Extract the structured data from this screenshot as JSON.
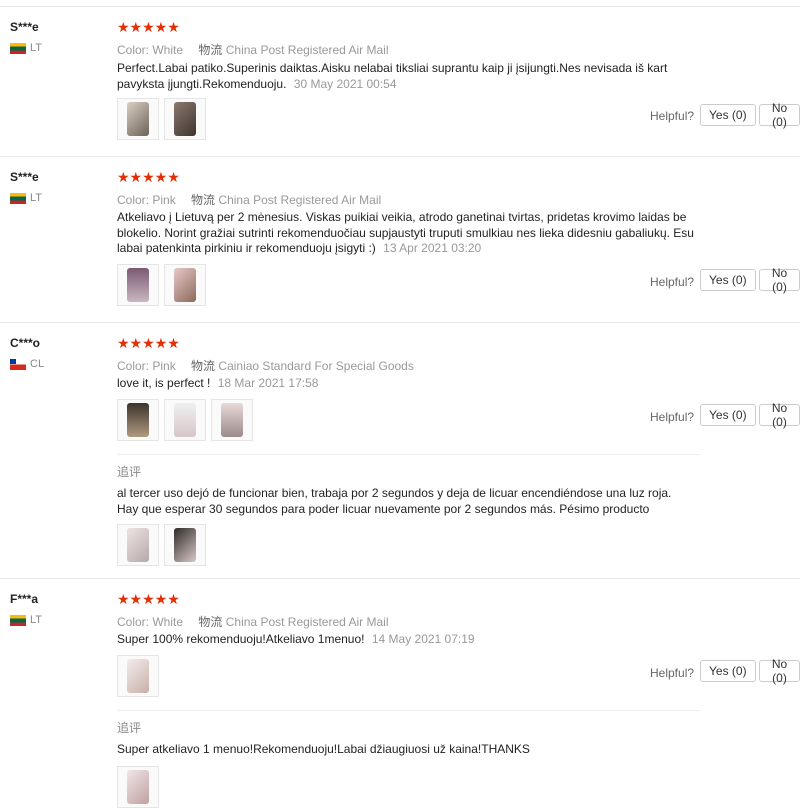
{
  "reviews": [
    {
      "user": "S***e",
      "country": "LT",
      "stars": "★★★★★",
      "color_label": "Color:",
      "color_value": "White",
      "logistics_label": "物流",
      "logistics_value": "China Post Registered Air Mail",
      "text": "Perfect.Labai patiko.Superinis daiktas.Aisku nelabai tiksliai suprantu kaip ji įsijungti.Nes nevisada iš kart pavyksta įjungti.Rekomenduoju.",
      "date": "30 May 2021 00:54",
      "helpful_label": "Helpful?",
      "yes_label": "Yes (0)",
      "no_label": "No (0)"
    },
    {
      "user": "S***e",
      "country": "LT",
      "stars": "★★★★★",
      "color_label": "Color:",
      "color_value": "Pink",
      "logistics_label": "物流",
      "logistics_value": "China Post Registered Air Mail",
      "text": "Atkeliavo į Lietuvą per 2 mėnesius. Viskas puikiai veikia, atrodo ganetinai tvirtas, pridetas krovimo laidas be blokelio. Norint gražiai sutrinti rekomenduočiau supjaustyti truputi smulkiau nes lieka didesniu gabaliukų. Esu labai patenkinta pirkiniu ir rekomenduoju įsigyti :)",
      "date": "13 Apr 2021 03:20",
      "helpful_label": "Helpful?",
      "yes_label": "Yes (0)",
      "no_label": "No (0)"
    },
    {
      "user": "C***o",
      "country": "CL",
      "stars": "★★★★★",
      "color_label": "Color:",
      "color_value": "Pink",
      "logistics_label": "物流",
      "logistics_value": "Cainiao Standard For Special Goods",
      "text": "love it, is perfect !",
      "date": "18 Mar 2021 17:58",
      "helpful_label": "Helpful?",
      "yes_label": "Yes (0)",
      "no_label": "No (0)",
      "additional_label": "追评",
      "additional_text": "al tercer uso dejó de funcionar bien, trabaja por 2 segundos y deja de licuar encendiéndose una luz roja. Hay que esperar 30 segundos para poder licuar nuevamente por 2 segundos más. Pésimo producto"
    },
    {
      "user": "F***a",
      "country": "LT",
      "stars": "★★★★★",
      "color_label": "Color:",
      "color_value": "White",
      "logistics_label": "物流",
      "logistics_value": "China Post Registered Air Mail",
      "text": "Super 100% rekomenduoju!Atkeliavo 1menuo!",
      "date": "14 May 2021 07:19",
      "helpful_label": "Helpful?",
      "yes_label": "Yes (0)",
      "no_label": "No (0)",
      "additional_label": "追评",
      "additional_text": "Super atkeliavo 1 menuo!Rekomenduoju!Labai džiaugiuosi už kaina!THANKS"
    }
  ],
  "colors": {
    "star": "#e62e04",
    "divider": "#e8e8e8"
  }
}
